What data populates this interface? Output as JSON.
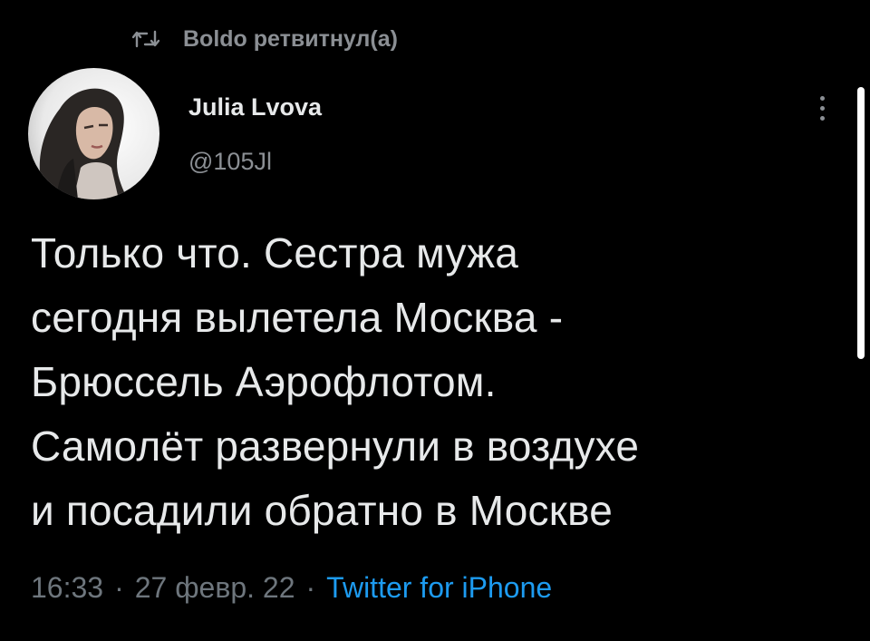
{
  "retweet": {
    "icon": "retweet-icon",
    "text": "Boldo ретвитнул(а)"
  },
  "author": {
    "avatar": "avatar",
    "name": "Julia Lvova",
    "handle": "@105Jl"
  },
  "more_menu": {
    "icon": "more-vertical-icon"
  },
  "tweet": {
    "lines": [
      "Только что. Сестра мужа",
      "сегодня вылетела Москва -",
      "Брюссель Аэрофлотом.",
      "Самолёт развернули в воздухе",
      "и посадили обратно в Москве"
    ]
  },
  "meta": {
    "time": "16:33",
    "separator": "·",
    "date": "27 февр. 22",
    "source": "Twitter for iPhone"
  },
  "colors": {
    "background": "#000000",
    "primary_text": "#e7e9ea",
    "secondary_text": "#8b8f94",
    "link": "#1d9bf0"
  }
}
